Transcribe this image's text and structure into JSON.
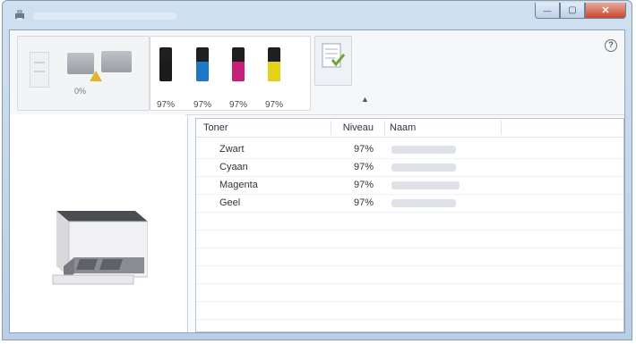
{
  "titlebar": {
    "buttons": [
      {
        "name": "minimize-button",
        "glyph": "—"
      },
      {
        "name": "maximize-button",
        "glyph": "▢"
      },
      {
        "name": "close-button",
        "glyph": "✕"
      }
    ]
  },
  "toolbar": {
    "paper_tray_percent": "0%",
    "toners": [
      {
        "color": "Zwart",
        "hex": "#1b1b1b",
        "percent": "97%"
      },
      {
        "color": "Cyaan",
        "hex": "#1e78c8",
        "percent": "97%"
      },
      {
        "color": "Magenta",
        "hex": "#c8207a",
        "percent": "97%"
      },
      {
        "color": "Geel",
        "hex": "#e2d21a",
        "percent": "97%"
      }
    ],
    "help_glyph": "?",
    "chevron_glyph": "▲"
  },
  "table": {
    "headers": {
      "toner": "Toner",
      "niveau": "Niveau",
      "naam": "Naam"
    },
    "rows": [
      {
        "toner": "Zwart",
        "niveau": "97%"
      },
      {
        "toner": "Cyaan",
        "niveau": "97%"
      },
      {
        "toner": "Magenta",
        "niveau": "97%"
      },
      {
        "toner": "Geel",
        "niveau": "97%"
      }
    ]
  }
}
